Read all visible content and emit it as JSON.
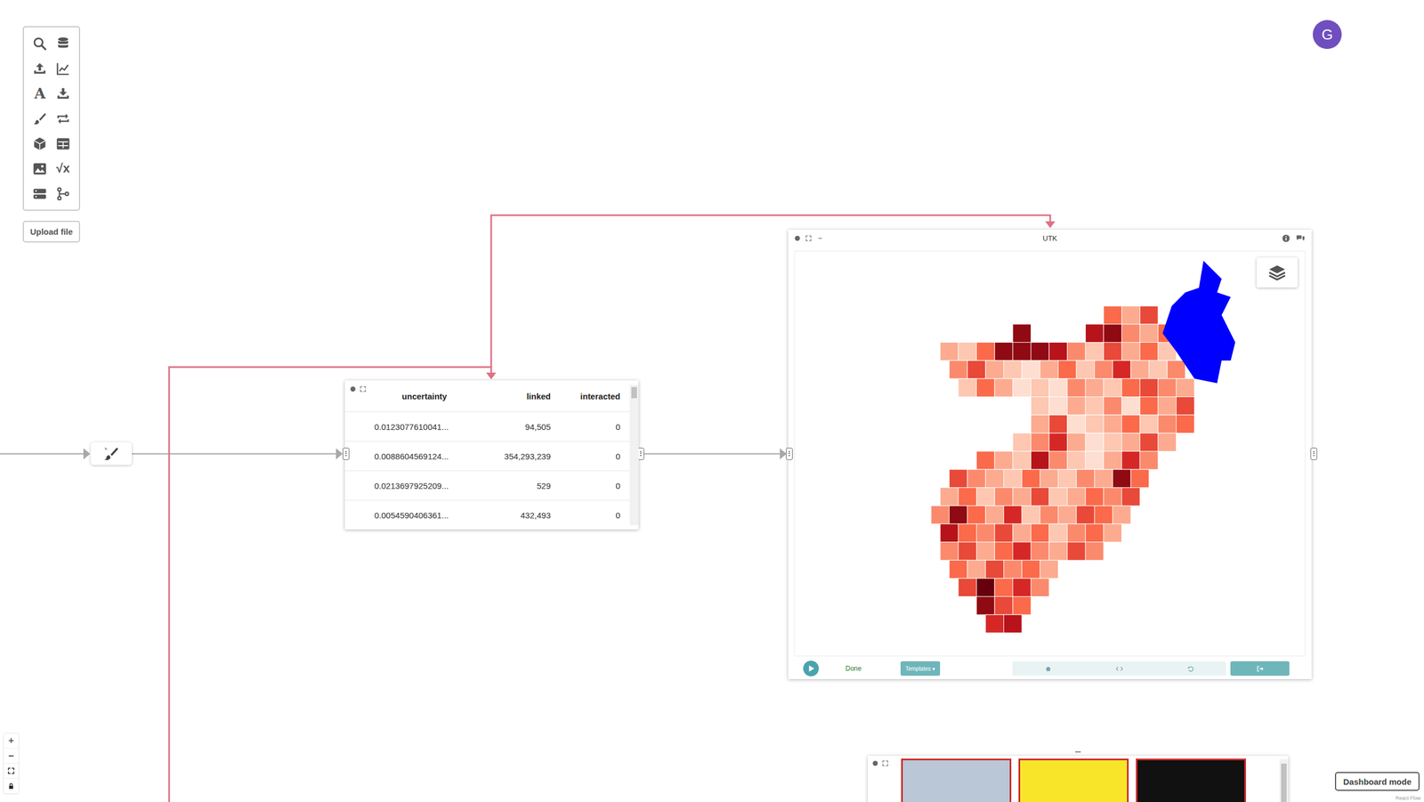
{
  "toolbar": {
    "text_tool": "A",
    "formula_tool": "√x"
  },
  "upload_button": "Upload file",
  "avatar": "G",
  "table": {
    "columns": [
      "uncertainty",
      "linked",
      "interacted"
    ],
    "rows": [
      [
        "0.0123077610041...",
        "94,505",
        "0"
      ],
      [
        "0.0088604569124...",
        "354,293,239",
        "0"
      ],
      [
        "0.0213697925209...",
        "529",
        "0"
      ],
      [
        "0.0054590406361...",
        "432,493",
        "0"
      ]
    ]
  },
  "utk": {
    "title": "UTK",
    "map": {
      "selected_region": true,
      "levels": [
        0.5,
        0.3,
        0.6,
        0.9,
        0.8,
        0.9,
        0.4,
        0.3,
        0.5,
        0.3,
        0.2,
        0.5,
        0.9,
        0.9,
        0.9,
        0.8,
        0.4,
        0.2,
        0.6,
        0.3,
        0.5,
        0.2,
        0.4,
        0.6,
        0.3,
        0.2,
        0.1,
        0.3,
        0.5,
        0.2,
        0.4,
        0.7,
        0.3,
        0.2,
        0.4,
        0.2,
        0.5,
        0.3,
        0.1,
        0.2,
        0.1,
        0.4,
        0.3,
        0.2,
        0.5,
        0.6,
        0.4,
        0.3,
        0.2,
        0.1,
        0.3,
        0.2,
        0.4,
        0.1,
        0.5,
        0.3,
        0.6,
        0.3,
        0.6,
        0.1,
        0.2,
        0.3,
        0.5,
        0.2,
        0.4,
        0.5,
        0.2,
        0.4,
        0.7,
        0.3,
        0.1,
        0.2,
        0.3,
        0.6,
        0.3,
        0.5,
        0.3,
        0.2,
        0.8,
        0.4,
        0.2,
        0.1,
        0.3,
        0.7,
        0.4,
        0.6,
        0.4,
        0.3,
        0.2,
        0.5,
        0.3,
        0.2,
        0.4,
        0.3,
        0.9,
        0.5,
        0.3,
        0.5,
        0.2,
        0.4,
        0.3,
        0.6,
        0.2,
        0.3,
        0.5,
        0.4,
        0.6,
        0.4,
        0.9,
        0.5,
        0.3,
        0.7,
        0.2,
        0.4,
        0.3,
        0.6,
        0.5,
        0.3,
        0.8,
        0.5,
        0.4,
        0.6,
        0.3,
        0.5,
        0.2,
        0.4,
        0.5,
        0.3,
        0.4,
        0.6,
        0.3,
        0.5,
        0.7,
        0.4,
        0.3,
        0.6,
        0.4,
        0.5,
        0.3,
        0.6,
        0.4,
        0.5,
        0.3,
        0.6,
        1.0,
        0.5,
        0.7,
        0.4,
        0.9,
        0.6,
        0.5,
        0.7,
        0.8
      ]
    },
    "footer": {
      "done": "Done",
      "templates": "Templates ▾"
    }
  },
  "gallery": {
    "images": [
      {
        "color": "#b9c7d6"
      },
      {
        "color": "#f8e52a"
      },
      {
        "color": "#111111"
      }
    ]
  },
  "zoom_controls": {
    "zoom_in": "+",
    "zoom_out": "−"
  },
  "dashboard_button": "Dashboard mode",
  "attribution": "React Flow"
}
